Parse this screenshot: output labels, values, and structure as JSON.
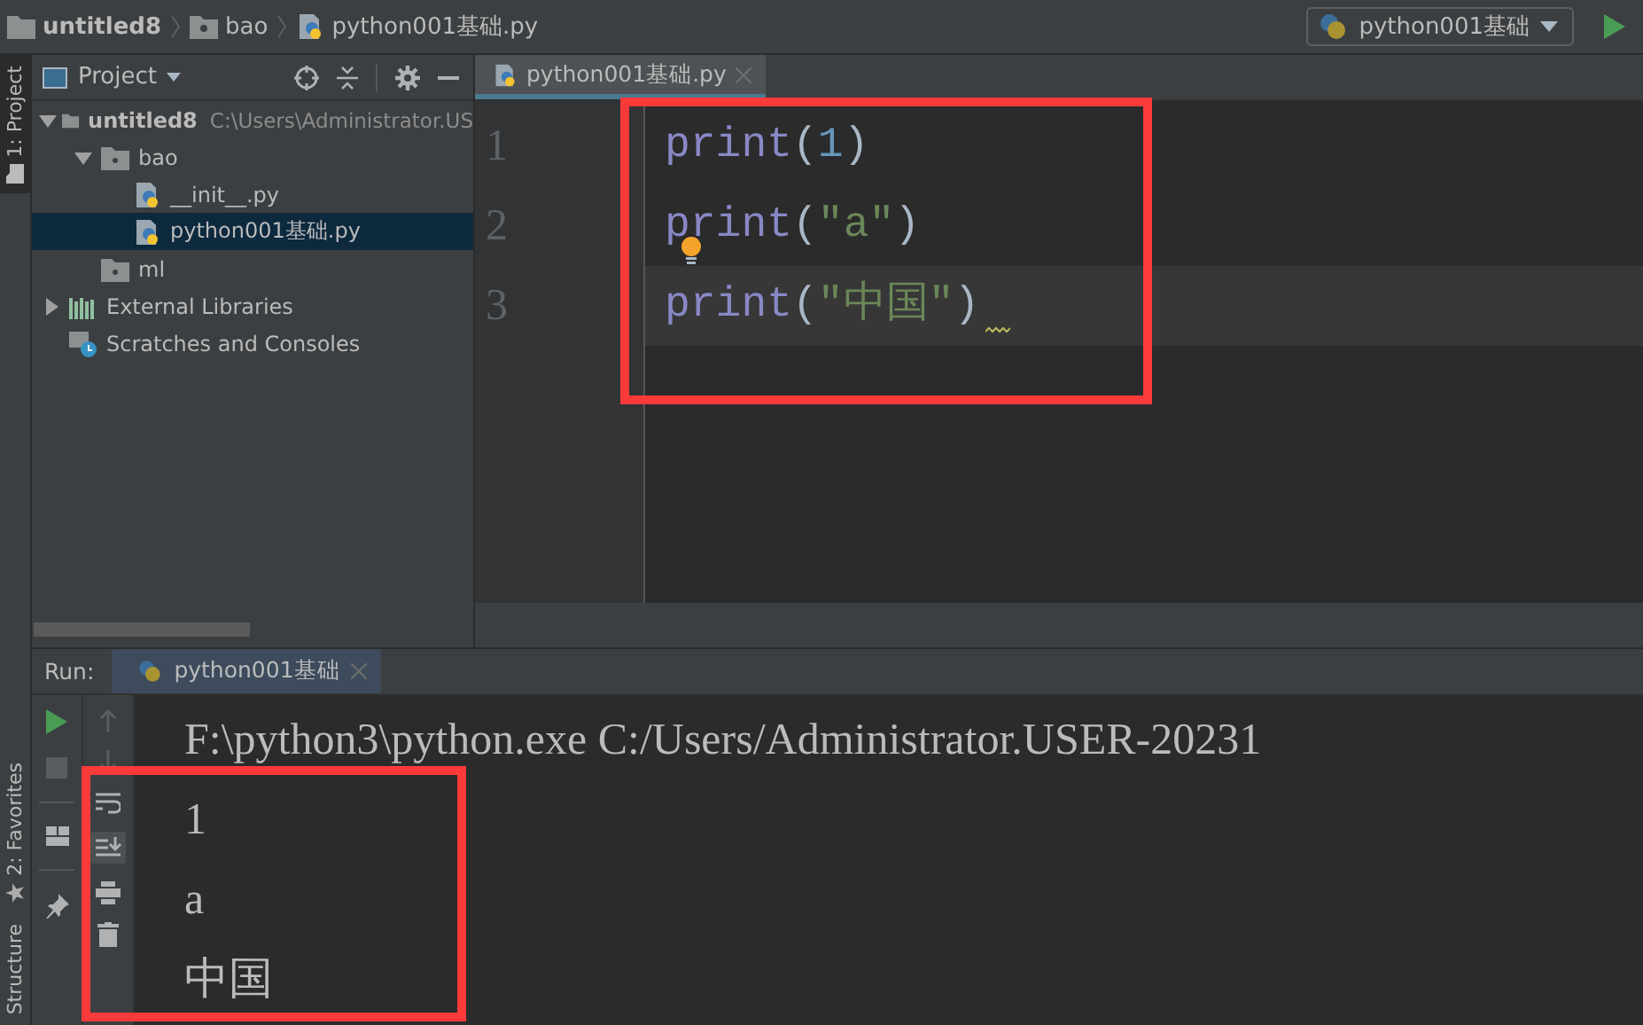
{
  "breadcrumbs": [
    {
      "label": "untitled8",
      "kind": "project"
    },
    {
      "label": "bao",
      "kind": "package"
    },
    {
      "label": "python001基础.py",
      "kind": "python"
    }
  ],
  "run_config": {
    "label": "python001基础"
  },
  "side_tabs": [
    {
      "label": "1: Project",
      "selected": true
    }
  ],
  "project_panel": {
    "title": "Project",
    "tree": [
      {
        "label": "untitled8",
        "path": "C:\\Users\\Administrator.US",
        "kind": "project",
        "expanded": true,
        "selected": false,
        "children": [
          {
            "label": "bao",
            "kind": "package",
            "expanded": true,
            "selected": false,
            "children": [
              {
                "label": "__init__.py",
                "kind": "python",
                "selected": false
              },
              {
                "label": "python001基础.py",
                "kind": "python",
                "selected": true
              }
            ]
          },
          {
            "label": "ml",
            "kind": "package",
            "selected": false
          }
        ]
      },
      {
        "label": "External Libraries",
        "kind": "libraries",
        "expanded": false,
        "selected": false
      },
      {
        "label": "Scratches and Consoles",
        "kind": "scratches",
        "selected": false
      }
    ]
  },
  "editor": {
    "tabs": [
      {
        "label": "python001基础.py",
        "selected": true
      }
    ],
    "lines": [
      {
        "number": "1",
        "current": false,
        "bulb": false,
        "warning": false,
        "tokens": [
          {
            "text": "print",
            "kind": "builtin"
          },
          {
            "text": "(",
            "kind": "plain"
          },
          {
            "text": "1",
            "kind": "number"
          },
          {
            "text": ")",
            "kind": "plain"
          }
        ]
      },
      {
        "number": "2",
        "current": false,
        "bulb": true,
        "warning": false,
        "tokens": [
          {
            "text": "print",
            "kind": "builtin"
          },
          {
            "text": "(",
            "kind": "plain"
          },
          {
            "text": "\"a\"",
            "kind": "string"
          },
          {
            "text": ")",
            "kind": "plain"
          }
        ]
      },
      {
        "number": "3",
        "current": true,
        "bulb": false,
        "warning": true,
        "tokens": [
          {
            "text": "print",
            "kind": "builtin"
          },
          {
            "text": "(",
            "kind": "plain"
          },
          {
            "text": "\"中国\"",
            "kind": "string"
          },
          {
            "text": ")",
            "kind": "plain"
          }
        ]
      }
    ]
  },
  "run_panel": {
    "label": "Run:",
    "tabs": [
      {
        "label": "python001基础",
        "selected": true
      }
    ],
    "output": [
      "F:\\python3\\python.exe C:/Users/Administrator.USER-20231",
      "1",
      "a",
      "中国"
    ]
  },
  "bottom_side_tabs": [
    {
      "label": "2: Favorites",
      "kind": "favorites"
    },
    {
      "label": "Structure",
      "kind": "structure"
    }
  ],
  "highlights": {
    "editor": true,
    "console": true
  }
}
